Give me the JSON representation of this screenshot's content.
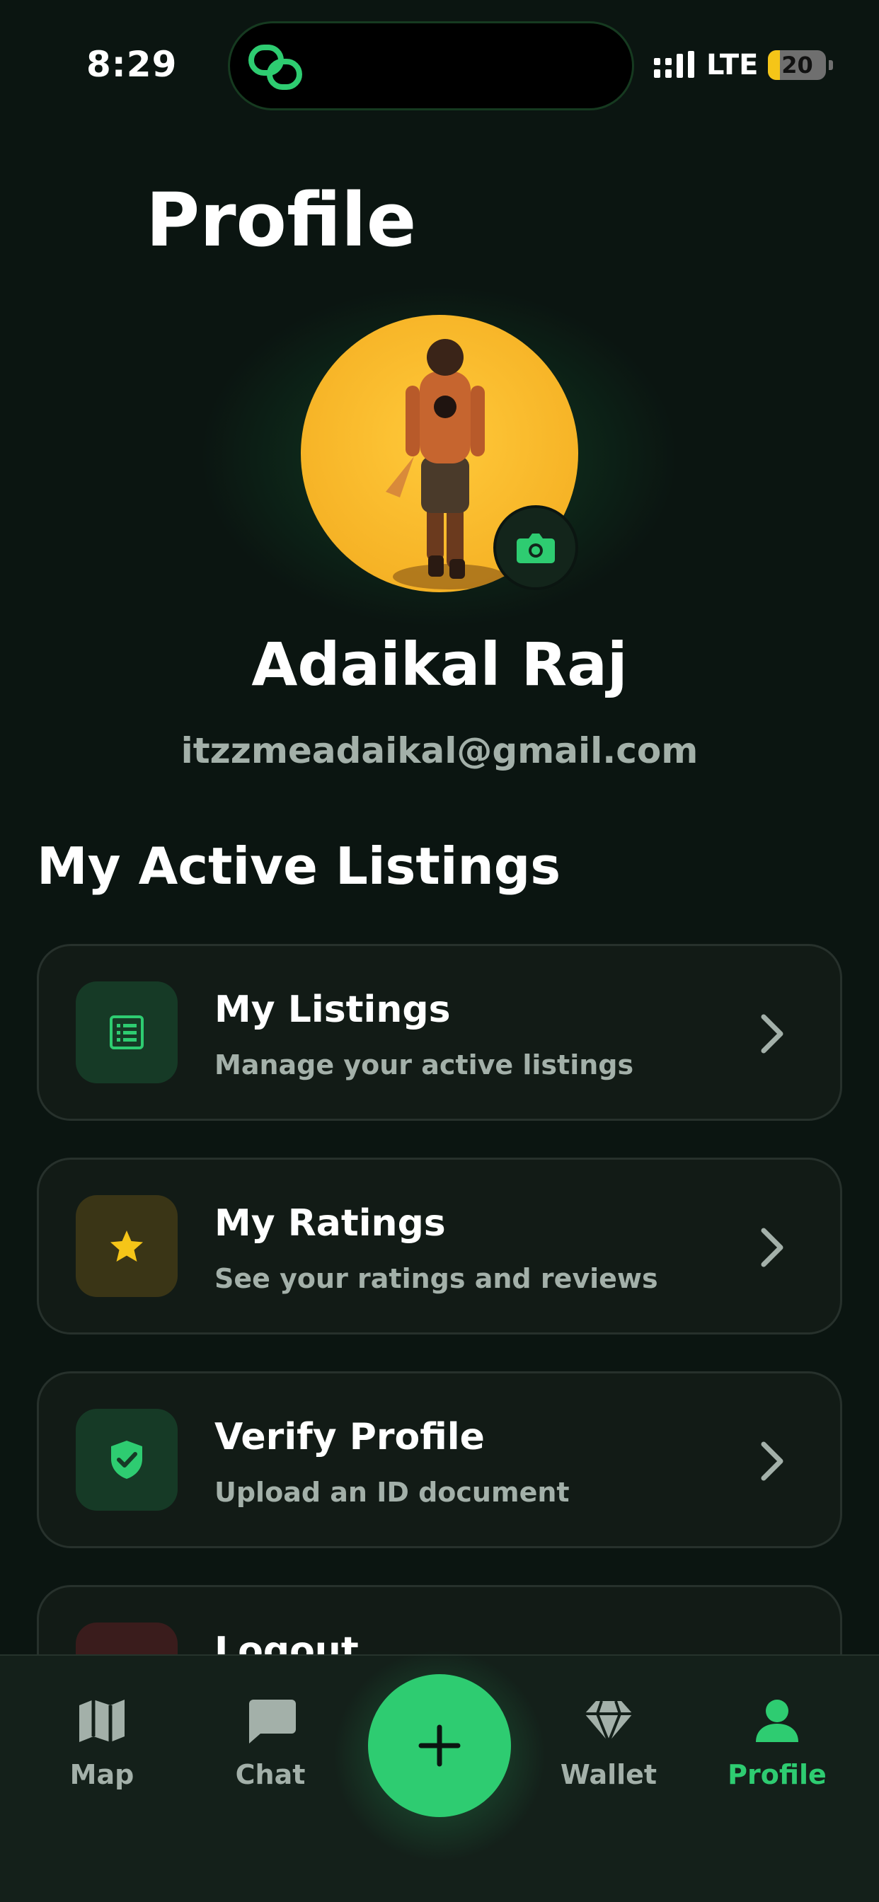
{
  "status_bar": {
    "time": "8:29",
    "network": "LTE",
    "battery": "20",
    "battery_level": 0.2
  },
  "page": {
    "title": "Profile"
  },
  "profile": {
    "name": "Adaikal Raj",
    "email": "itzzmeadaikal@gmail.com"
  },
  "section": {
    "title": "My Active Listings"
  },
  "menu": [
    {
      "title": "My Listings",
      "subtitle": "Manage your active listings",
      "icon": "list-icon",
      "color": "#2ecc71"
    },
    {
      "title": "My Ratings",
      "subtitle": "See your ratings and reviews",
      "icon": "star-icon",
      "color": "#f5c518"
    },
    {
      "title": "Verify Profile",
      "subtitle": "Upload an ID document",
      "icon": "shield-check-icon",
      "color": "#2ecc71"
    },
    {
      "title": "Logout",
      "subtitle": "",
      "icon": "logout-icon",
      "color": "#e74c3c"
    }
  ],
  "nav": {
    "items": [
      {
        "label": "Map",
        "icon": "map-icon"
      },
      {
        "label": "Chat",
        "icon": "chat-icon"
      },
      {
        "label": "Wallet",
        "icon": "wallet-icon"
      },
      {
        "label": "Profile",
        "icon": "profile-icon"
      }
    ],
    "active": "Profile",
    "fab_icon": "plus-icon"
  },
  "colors": {
    "accent": "#2ecc71",
    "background": "#0b1511",
    "card": "#121b16",
    "muted_text": "#a3b0a9",
    "star": "#f5c518"
  }
}
